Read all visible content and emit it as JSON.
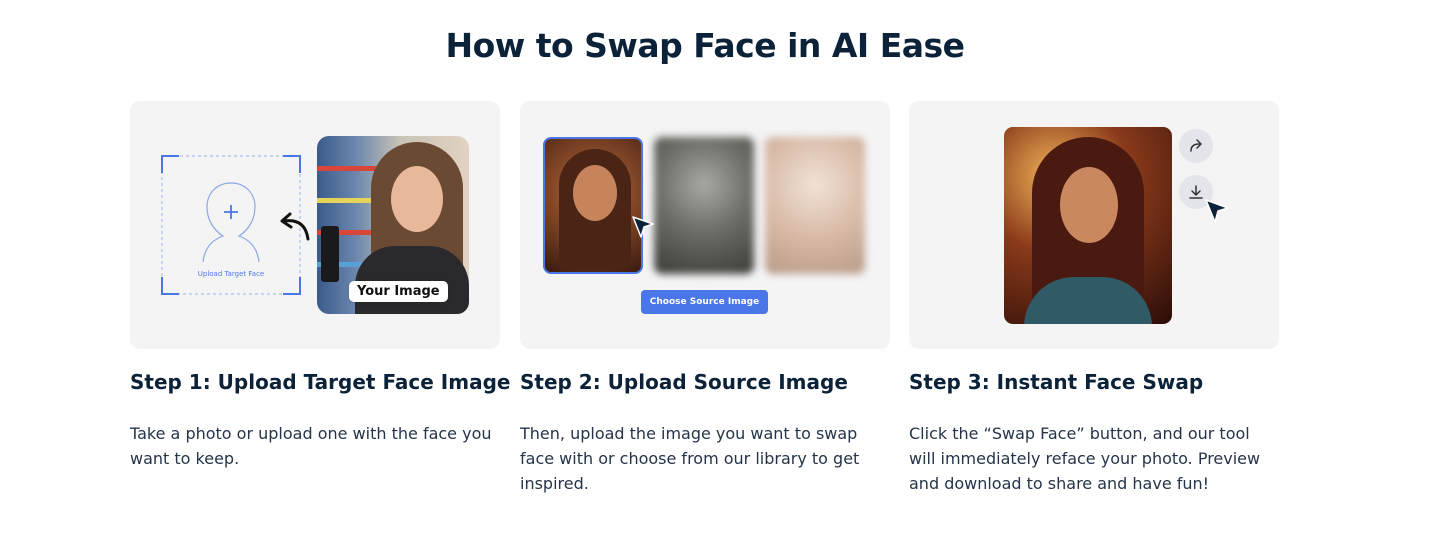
{
  "page": {
    "title": "How to Swap Face in AI Ease"
  },
  "steps": [
    {
      "title": "Step 1: Upload Target Face Image",
      "description": "Take a photo or upload one with the face you want to keep.",
      "illustration": {
        "upload_label": "Upload Target Face",
        "image_tag": "Your Image"
      }
    },
    {
      "title": "Step 2: Upload Source Image",
      "description": "Then, upload the image you want to swap face with or choose from our library to get inspired.",
      "illustration": {
        "button_label": "Choose Source Image"
      }
    },
    {
      "title": "Step 3: Instant Face Swap",
      "description": "Click the “Swap Face” button, and our tool will immediately reface your photo. Preview and download to share and have fun!",
      "illustration": {
        "icons": [
          "share-icon",
          "download-icon"
        ]
      }
    }
  ],
  "colors": {
    "heading": "#0c2238",
    "accent": "#4a76e8",
    "card_bg": "#f4f4f5"
  }
}
